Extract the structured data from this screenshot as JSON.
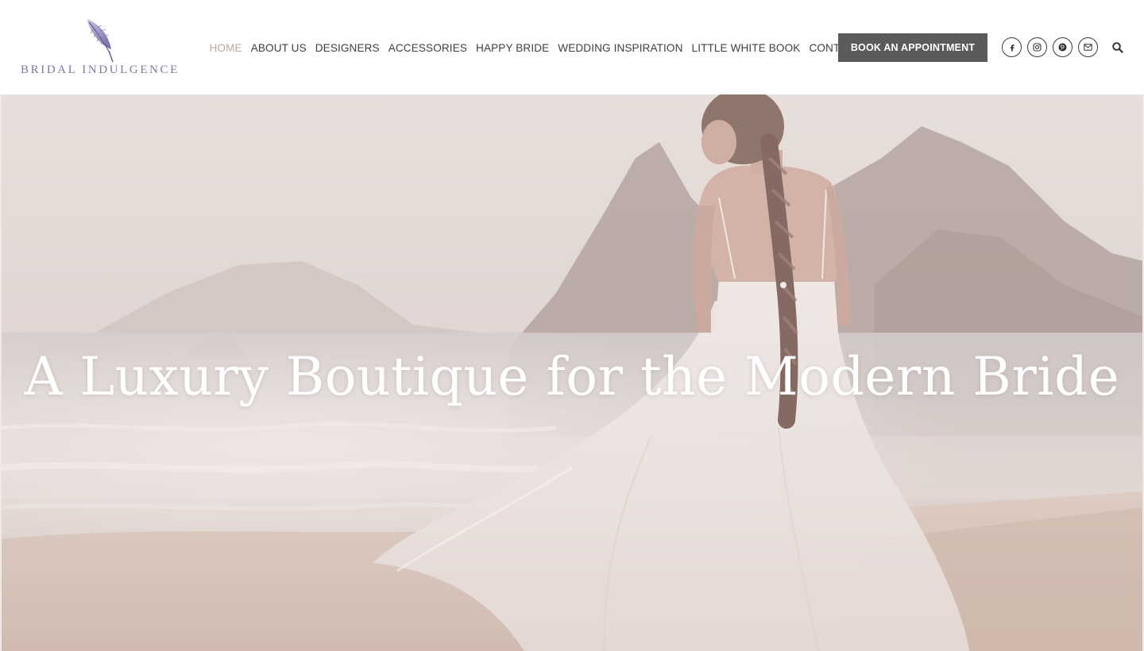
{
  "brand": {
    "name": "BRIDAL INDULGENCE",
    "logo_icon": "feather-icon",
    "accent_color": "#7d78a8"
  },
  "nav": {
    "items": [
      {
        "label": "HOME",
        "active": true
      },
      {
        "label": "ABOUT US",
        "active": false
      },
      {
        "label": "DESIGNERS",
        "active": false
      },
      {
        "label": "ACCESSORIES",
        "active": false
      },
      {
        "label": "HAPPY BRIDE",
        "active": false
      },
      {
        "label": "WEDDING INSPIRATION",
        "active": false
      },
      {
        "label": "LITTLE WHITE BOOK",
        "active": false
      },
      {
        "label": "CONTACT",
        "active": false
      }
    ],
    "active_color": "#b9a8a3",
    "text_color": "#3f3f3f"
  },
  "cta": {
    "label": "BOOK AN APPOINTMENT",
    "background": "#5b5b5d"
  },
  "social": [
    {
      "icon": "facebook-icon"
    },
    {
      "icon": "instagram-icon"
    },
    {
      "icon": "pinterest-icon"
    },
    {
      "icon": "email-icon"
    }
  ],
  "search": {
    "icon": "search-icon"
  },
  "hero": {
    "title": "A Luxury Boutique for the Modern Bride",
    "image": "bride-on-beach-photo"
  }
}
